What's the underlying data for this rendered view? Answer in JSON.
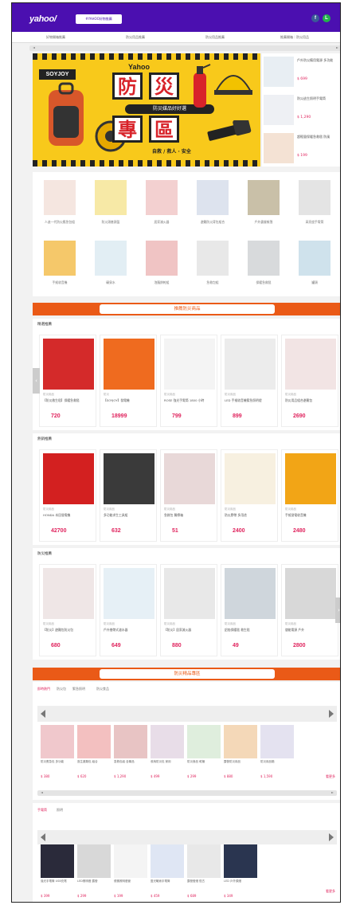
{
  "header": {
    "logo": "yahoo/",
    "breadcrumb": "#YAHOO好物推薦",
    "fb": "f",
    "line": "L"
  },
  "nav": [
    "好物開箱推薦",
    "防災用品推薦",
    "防災用品推薦",
    "推薦開箱｜防災用品"
  ],
  "banner": {
    "yahoo": "Yahoo",
    "chars": [
      "防",
      "災",
      "專",
      "區"
    ],
    "pill": "防災媒品好好選",
    "sub": "自救 / 救人 · 安全",
    "brand": "SOYJOY"
  },
  "side": [
    {
      "text": "戶外防災備用電源 多功能",
      "price": "$ 699"
    },
    {
      "text": "防災逃生照明手電筒",
      "price": "$ 1,290"
    },
    {
      "text": "超輕量保暖急救毯 防風",
      "price": "$ 199"
    }
  ],
  "grid": [
    "人造一代防災應急包組",
    "防災頭套頭盔",
    "居家滅火器",
    "避難防災背包組合",
    "戶外露營帳篷",
    "高亮度手電筒",
    "手搖收音機",
    "礦泉水",
    "泡麵餅乾組",
    "急救包組",
    "保暖急救毯",
    "罐頭"
  ],
  "section1": "推薦防災商品",
  "rows": [
    {
      "title": "精選推薦",
      "items": [
        {
          "shop": "防災用品",
          "name": "【防災救生毯】保暖急救毯",
          "price": "720"
        },
        {
          "shop": "防災",
          "name": "【SOYJOY】發電機",
          "price": "18999"
        },
        {
          "shop": "防災用品",
          "name": "ROSE 強光手電筒 1800 小時",
          "price": "799"
        },
        {
          "shop": "防災用品",
          "name": "LED 手搖收音機緊急照明燈",
          "price": "899"
        },
        {
          "shop": "防災用品",
          "name": "防災用品組合避難包",
          "price": "2690"
        }
      ]
    },
    {
      "title": "熱銷推薦",
      "items": [
        {
          "shop": "防災用品",
          "name": "HONDA 本田發電機",
          "price": "42700"
        },
        {
          "shop": "防災用品",
          "name": "多功能求生工具組",
          "price": "632"
        },
        {
          "shop": "防災用品",
          "name": "急救包 醫療箱",
          "price": "51"
        },
        {
          "shop": "防災用品",
          "name": "防災膠帶 多用途",
          "price": "2400"
        },
        {
          "shop": "防災用品",
          "name": "手搖發電收音機",
          "price": "2480"
        }
      ]
    },
    {
      "title": "防災推薦",
      "items": [
        {
          "shop": "防災用品",
          "name": "【防災】避難包防災包",
          "price": "680"
        },
        {
          "shop": "防災用品",
          "name": "戶外攜帶式濾水器",
          "price": "649"
        },
        {
          "shop": "防災用品",
          "name": "【防災】居家滅火器",
          "price": "880"
        },
        {
          "shop": "防災用品",
          "name": "鋁箔保暖毯 救生毯",
          "price": "49"
        },
        {
          "shop": "防災用品",
          "name": "儲能電源 戶外",
          "price": "2800"
        }
      ]
    }
  ],
  "section2": "防災精品專區",
  "tabs1": [
    "即時熱門",
    "防災包",
    "緊急照明",
    "防災食品"
  ],
  "minis1": [
    {
      "name": "防災應急包 多功能",
      "price": "$ 380"
    },
    {
      "name": "逃生避難包 組合",
      "price": "$ 620"
    },
    {
      "name": "急救包組 含藥品",
      "price": "$ 1,290"
    },
    {
      "name": "收納防災包 家用",
      "price": "$ 499"
    },
    {
      "name": "防災食品 乾糧",
      "price": "$ 299"
    },
    {
      "name": "露營防災用品",
      "price": "$ 880"
    },
    {
      "name": "防災用品箱",
      "price": "$ 1,590"
    }
  ],
  "more1": "看更多",
  "tabs2": [
    "手電筒",
    "照明"
  ],
  "minis2": [
    {
      "name": "強光手電筒 USB充電",
      "price": "$ 399"
    },
    {
      "name": "LED照明燈 露營",
      "price": "$ 299"
    },
    {
      "name": "便攜照明燈管",
      "price": "$ 199"
    },
    {
      "name": "藍光戰術手電筒",
      "price": "$ 459"
    },
    {
      "name": "露營營燈 復古",
      "price": "$ 689"
    },
    {
      "name": "LED 戶外頭燈",
      "price": "$ 349"
    }
  ],
  "more2": "看更多"
}
